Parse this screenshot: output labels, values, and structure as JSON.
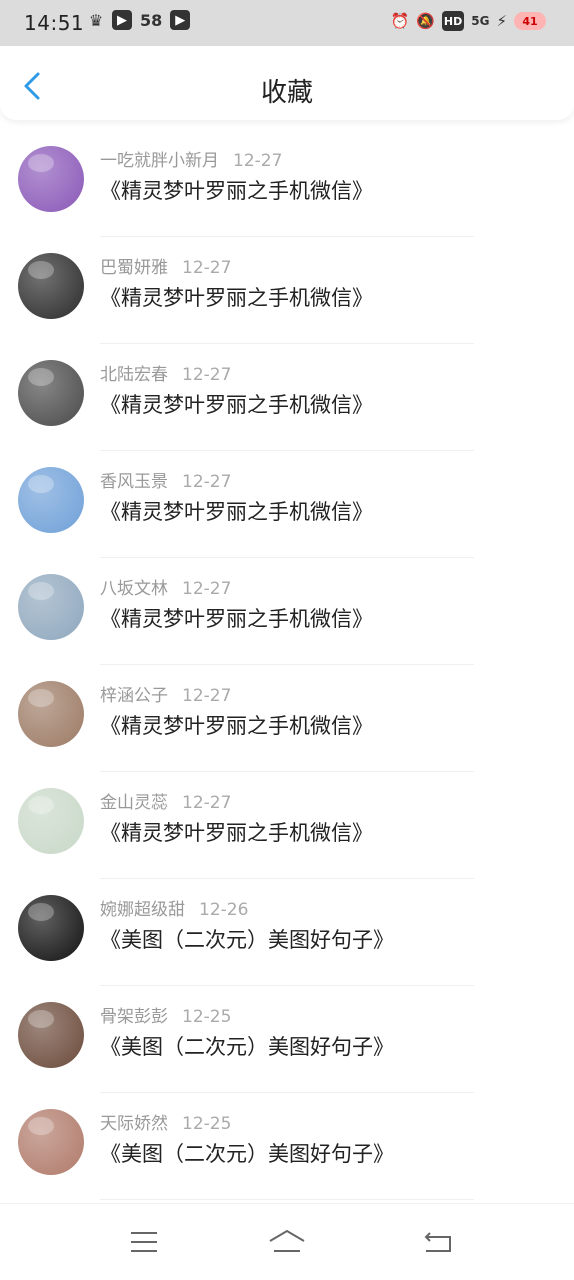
{
  "status_bar": {
    "time": "14:51",
    "left_icons": [
      "crown-icon",
      "play-app-icon",
      "58",
      "video-app-icon"
    ],
    "right_icons": [
      "alarm-icon",
      "mute-icon",
      "HD",
      "5G",
      "charging-icon"
    ],
    "battery": "41"
  },
  "header": {
    "title": "收藏"
  },
  "items": [
    {
      "username": "一吃就胖小新月",
      "date": "12-27",
      "book": "《精灵梦叶罗丽之手机微信》",
      "avatar_color": "#8a58b8"
    },
    {
      "username": "巴蜀妍雅",
      "date": "12-27",
      "book": "《精灵梦叶罗丽之手机微信》",
      "avatar_color": "#2b2b2b"
    },
    {
      "username": "北陆宏春",
      "date": "12-27",
      "book": "《精灵梦叶罗丽之手机微信》",
      "avatar_color": "#4a4a4a"
    },
    {
      "username": "香风玉景",
      "date": "12-27",
      "book": "《精灵梦叶罗丽之手机微信》",
      "avatar_color": "#6fa0d8"
    },
    {
      "username": "八坂文林",
      "date": "12-27",
      "book": "《精灵梦叶罗丽之手机微信》",
      "avatar_color": "#8ea7bd"
    },
    {
      "username": "梓涵公子",
      "date": "12-27",
      "book": "《精灵梦叶罗丽之手机微信》",
      "avatar_color": "#9c7a64"
    },
    {
      "username": "金山灵蕊",
      "date": "12-27",
      "book": "《精灵梦叶罗丽之手机微信》",
      "avatar_color": "#c8d8c8"
    },
    {
      "username": "婉娜超级甜",
      "date": "12-26",
      "book": "《美图（二次元）美图好句子》",
      "avatar_color": "#111111"
    },
    {
      "username": "骨架彭彭",
      "date": "12-25",
      "book": "《美图（二次元）美图好句子》",
      "avatar_color": "#6b4a3a"
    },
    {
      "username": "天际娇然",
      "date": "12-25",
      "book": "《美图（二次元）美图好句子》",
      "avatar_color": "#b07a6a"
    }
  ],
  "nav": {
    "menu_icon": "menu-icon",
    "home_icon": "home-icon",
    "back_icon": "back-icon"
  },
  "colors": {
    "accent": "#2e9ae8",
    "meta_text": "#999999",
    "title_text": "#222222"
  }
}
